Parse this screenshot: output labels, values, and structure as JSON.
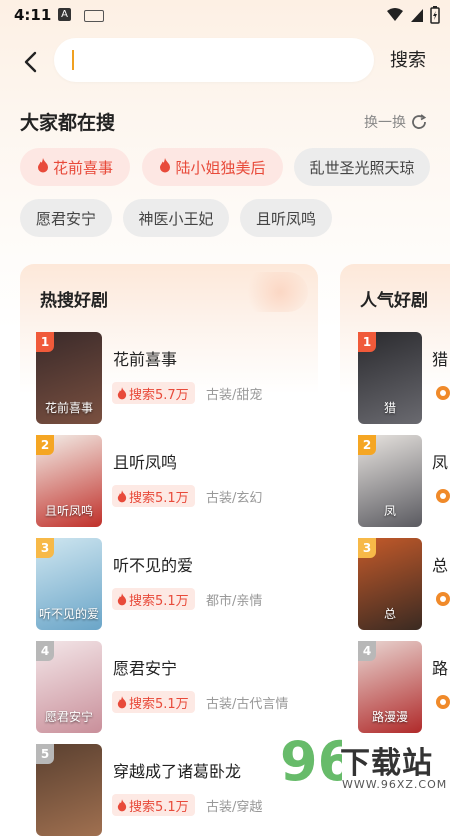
{
  "status": {
    "time": "4:11",
    "notif_letter": "A"
  },
  "search": {
    "value": "",
    "placeholder": "",
    "submit_label": "搜索"
  },
  "hot_searches": {
    "title": "大家都在搜",
    "shuffle_label": "换一换",
    "tags": [
      {
        "label": "花前喜事",
        "hot": true
      },
      {
        "label": "陆小姐独美后",
        "hot": true
      },
      {
        "label": "乱世圣光照天琼",
        "hot": false
      },
      {
        "label": "愿君安宁",
        "hot": false
      },
      {
        "label": "神医小王妃",
        "hot": false
      },
      {
        "label": "且听凤鸣",
        "hot": false
      }
    ]
  },
  "hot_dramas": {
    "title": "热搜好剧",
    "items": [
      {
        "rank": "1",
        "title": "花前喜事",
        "hot": "搜索5.7万",
        "genre": "古装/甜宠",
        "poster_text": "花前喜事",
        "rank_color": "#f05a3a",
        "poster_colors": [
          "#3a2a2a",
          "#7a5040"
        ]
      },
      {
        "rank": "2",
        "title": "且听凤鸣",
        "hot": "搜索5.1万",
        "genre": "古装/玄幻",
        "poster_text": "且听凤鸣",
        "rank_color": "#f5a623",
        "poster_colors": [
          "#f3efe9",
          "#c0302a"
        ]
      },
      {
        "rank": "3",
        "title": "听不见的爱",
        "hot": "搜索5.1万",
        "genre": "都市/亲情",
        "poster_text": "听不见的爱",
        "rank_color": "#f7b948",
        "poster_colors": [
          "#cfe6f0",
          "#6aa5c8"
        ]
      },
      {
        "rank": "4",
        "title": "愿君安宁",
        "hot": "搜索5.1万",
        "genre": "古装/古代言情",
        "poster_text": "愿君安宁",
        "rank_color": "#b8b8b8",
        "poster_colors": [
          "#f3e6e8",
          "#c98f9a"
        ]
      },
      {
        "rank": "5",
        "title": "穿越成了诸葛卧龙",
        "hot": "搜索5.1万",
        "genre": "古装/穿越",
        "poster_text": "",
        "rank_color": "#b8b8b8",
        "poster_colors": [
          "#5a4030",
          "#a07050"
        ]
      }
    ]
  },
  "popular_dramas": {
    "title": "人气好剧",
    "items": [
      {
        "rank": "1",
        "char": "猎",
        "poster_text": "猎",
        "rank_color": "#f05a3a",
        "poster_colors": [
          "#2a2a2e",
          "#6a6a70"
        ]
      },
      {
        "rank": "2",
        "char": "凤",
        "poster_text": "凤",
        "rank_color": "#f5a623",
        "poster_colors": [
          "#e8e4e0",
          "#5a5a60"
        ]
      },
      {
        "rank": "3",
        "char": "总",
        "poster_text": "总",
        "rank_color": "#f7b948",
        "poster_colors": [
          "#c45a2a",
          "#3a2a22"
        ]
      },
      {
        "rank": "4",
        "char": "路",
        "poster_text": "路漫漫",
        "rank_color": "#b8b8b8",
        "poster_colors": [
          "#e9d6d2",
          "#b02a2a"
        ]
      }
    ]
  },
  "watermark": {
    "text": "下载站",
    "number": "96",
    "sub": "WWW.96XZ.COM"
  },
  "colors": {
    "accent": "#e84a3a",
    "caret": "#f0a020"
  }
}
